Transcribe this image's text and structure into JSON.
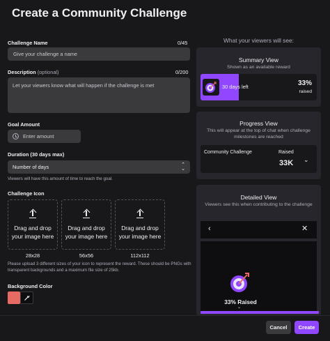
{
  "header": {
    "title": "Create a Community Challenge"
  },
  "form": {
    "challenge_name": {
      "label": "Challenge Name",
      "counter": "0/45",
      "placeholder": "Give your challenge a name"
    },
    "description": {
      "label": "Description",
      "optional": "(optional)",
      "counter": "0/200",
      "placeholder": "Let your viewers know what will happen if the challenge is met"
    },
    "goal_amount": {
      "label": "Goal Amount",
      "placeholder": "Enter amount",
      "icon": "clock-icon"
    },
    "duration": {
      "label": "Duration (30 days max)",
      "selected": "Number of days",
      "hint": "Viewers will have this amount of time to reach the goal."
    },
    "icon": {
      "label": "Challenge Icon",
      "dropzones": [
        {
          "text": "Drag and drop your image here",
          "size": "28x28"
        },
        {
          "text": "Drag and drop your image here",
          "size": "56x56"
        },
        {
          "text": "Drag and drop your image here",
          "size": "112x112"
        }
      ],
      "hint": "Please upload 3 different sizes of your icon to represent the reward. These should be PNGs with transparent backgrounds and a maximum file size of 25kb."
    },
    "background": {
      "label": "Background Color",
      "color": "#e76a63"
    }
  },
  "preview": {
    "heading": "What your viewers will see:",
    "summary": {
      "title": "Summary View",
      "subtitle": "Shown as an available reward",
      "time_left": "30 days left",
      "percent": "33%",
      "raised_label": "raised",
      "progress": 0.33
    },
    "progress_view": {
      "title": "Progress View",
      "subtitle": "This will appear at the top of chat when challenge milestones are reached",
      "challenge_name": "Community Challenge",
      "raised_label": "Raised",
      "amount": "33K"
    },
    "detailed": {
      "title": "Detailed View",
      "subtitle": "Viewers see this when contributing to the challenge",
      "back": "‹",
      "close": "✕",
      "raised_text": "33% Raised"
    }
  },
  "footer": {
    "cancel": "Cancel",
    "create": "Create"
  },
  "colors": {
    "accent": "#9147ff",
    "background": "#18181b",
    "surface": "#26262c",
    "input": "#3a3a3d"
  }
}
